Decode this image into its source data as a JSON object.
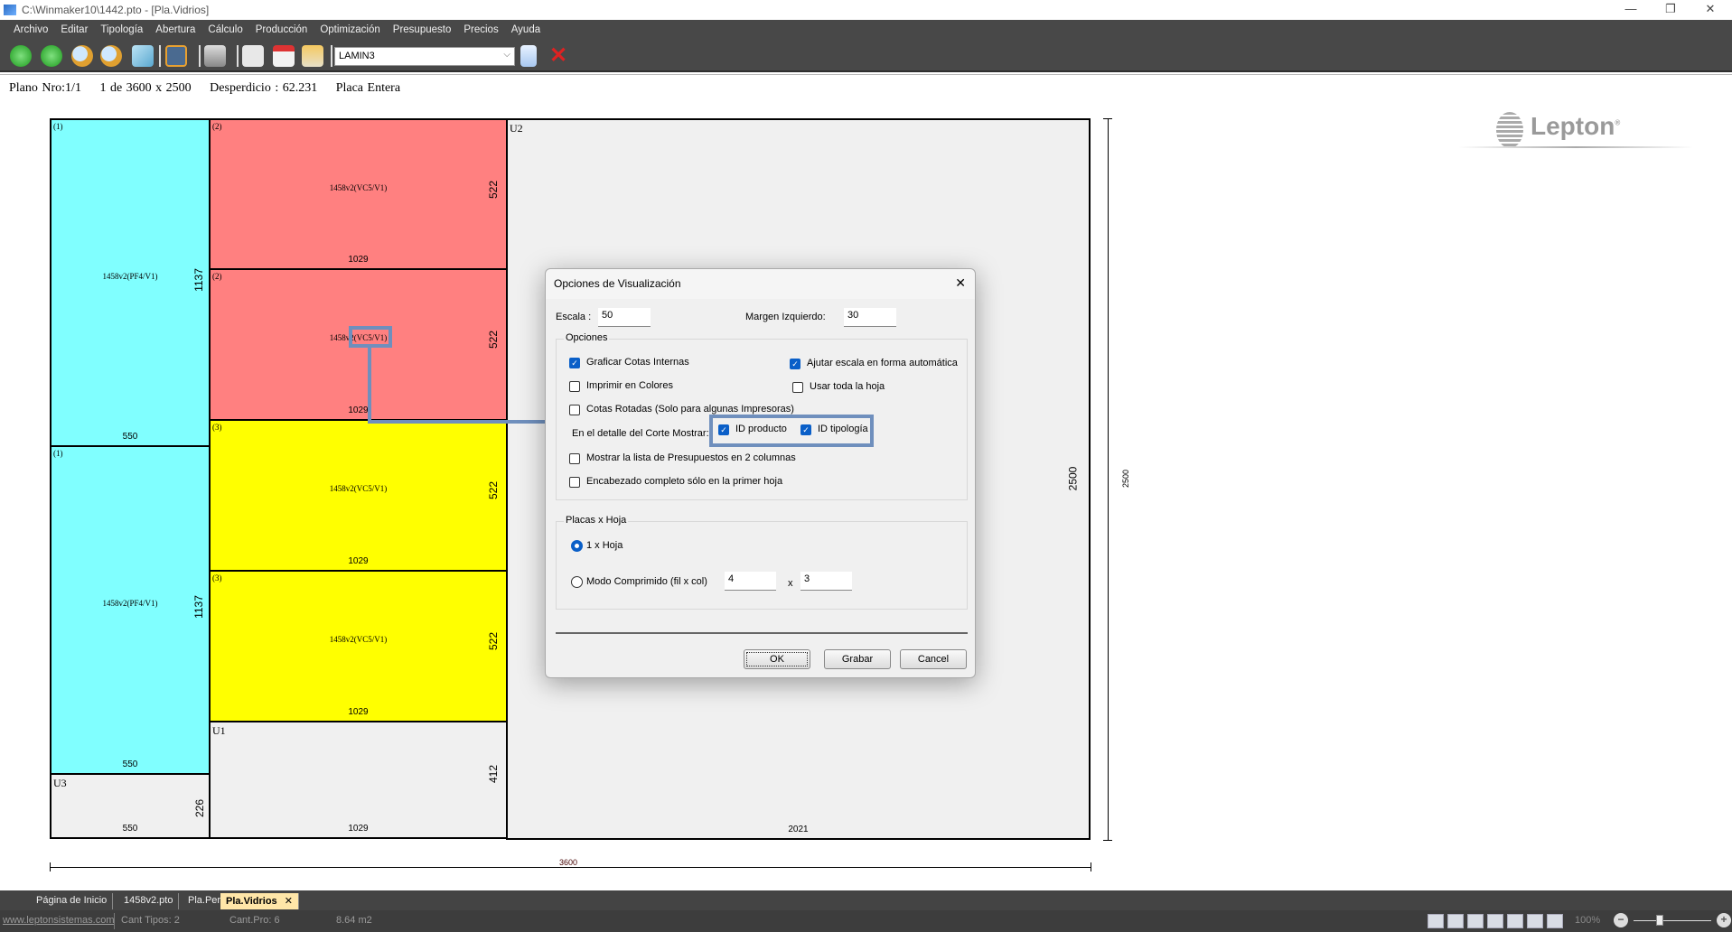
{
  "window": {
    "title": "C:\\Winmaker10\\1442.pto - [Pla.Vidrios]",
    "minimize": "—",
    "maximize": "❐",
    "close": "✕"
  },
  "menu": [
    "Archivo",
    "Editar",
    "Tipología",
    "Abertura",
    "Cálculo",
    "Producción",
    "Optimización",
    "Presupuesto",
    "Precios",
    "Ayuda"
  ],
  "toolbar": {
    "material": "LAMIN3",
    "combo_chevron": "⌵"
  },
  "info": {
    "plano": "Plano Nro:1/1",
    "placa": "1 de 3600 x 2500",
    "desperdicio": "Desperdicio : 62.231",
    "tipo": "Placa Entera"
  },
  "pieces": [
    {
      "num": "(1)",
      "label": "1458v2(PF4/V1)",
      "w": "550",
      "h": "1137",
      "color": "#80ffff"
    },
    {
      "num": "(1)",
      "label": "1458v2(PF4/V1)",
      "w": "550",
      "h": "1137",
      "color": "#80ffff"
    },
    {
      "num": "(2)",
      "label": "1458v2(VC5/V1)",
      "w": "1029",
      "h": "522",
      "color": "#ff8080"
    },
    {
      "num": "(2)",
      "label": "1458v2(VC5/V1)",
      "w": "1029",
      "h": "522",
      "color": "#ff8080"
    },
    {
      "num": "(3)",
      "label": "1458v2(VC5/V1)",
      "w": "1029",
      "h": "522",
      "color": "#ffff00"
    },
    {
      "num": "(3)",
      "label": "1458v2(VC5/V1)",
      "w": "1029",
      "h": "522",
      "color": "#ffff00"
    }
  ],
  "waste": [
    {
      "name": "U1",
      "w": "1029",
      "h": "412"
    },
    {
      "name": "U2",
      "w": "2021",
      "h": "2500"
    },
    {
      "name": "U3",
      "w": "550",
      "h": "226"
    }
  ],
  "dimensions": {
    "total_width": "3600",
    "total_height": "2500"
  },
  "logo": {
    "text": "Lepton",
    "mark": "®"
  },
  "dialog": {
    "title": "Opciones de Visualización",
    "close": "✕",
    "escala_label": "Escala :",
    "escala": "50",
    "margen_label": "Margen Izquierdo:",
    "margen": "30",
    "opciones_group": "Opciones",
    "options": [
      {
        "label": "Graficar Cotas Internas",
        "checked": true
      },
      {
        "label": "Imprimir en Colores",
        "checked": false
      },
      {
        "label": "Cotas Rotadas (Solo para algunas Impresoras)",
        "checked": false
      },
      {
        "label": "Ajutar escala en forma automática",
        "checked": true
      },
      {
        "label": "Usar toda la hoja",
        "checked": false
      },
      {
        "label": "Mostrar la lista de Presupuestos en 2 columnas",
        "checked": false
      },
      {
        "label": "Encabezado completo sólo en la primer hoja",
        "checked": false
      }
    ],
    "detalle_label": "En el detalle del Corte Mostrar:",
    "id_producto": {
      "label": "ID producto",
      "checked": true
    },
    "id_tipologia": {
      "label": "ID tipología",
      "checked": true
    },
    "placas_group": "Placas x Hoja",
    "radio_1": {
      "label": "1 x Hoja",
      "selected": true
    },
    "radio_2": {
      "label": "Modo Comprimido (fil x col)",
      "selected": false
    },
    "filas": "4",
    "x_sep": "x",
    "columnas": "3",
    "ok": "OK",
    "grabar": "Grabar",
    "cancel": "Cancel",
    "check": "✓"
  },
  "tabs": [
    {
      "label": "Página de Inicio"
    },
    {
      "label": "1458v2.pto"
    },
    {
      "label": "Pla.Per"
    },
    {
      "label": "Pla.Vidrios",
      "active": true,
      "close": "✕"
    }
  ],
  "status": {
    "link": "www.leptonsistemas.com",
    "tipos": "Cant Tipos: 2",
    "pro": "Cant.Pro: 6",
    "area": "8.64 m2",
    "zoom": "100%",
    "zoom_out": "−",
    "zoom_in": "+"
  },
  "colors": {
    "accent": "#0a5fc8",
    "highlight": "#6f8fbd"
  }
}
